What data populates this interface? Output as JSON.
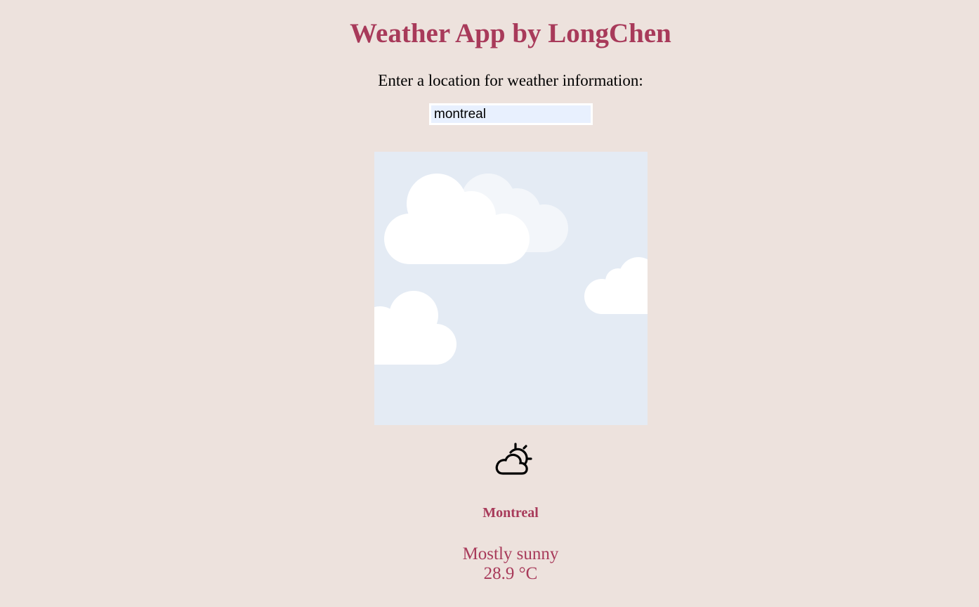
{
  "app": {
    "title": "Weather App by LongChen"
  },
  "search": {
    "prompt": "Enter a location for weather information:",
    "value": "montreal"
  },
  "weather": {
    "image_icon": "clouds-illustration",
    "condition_icon": "partly-sunny-icon",
    "city": "Montreal",
    "condition": "Mostly sunny",
    "temperature": "28.9 °C"
  },
  "colors": {
    "background": "#ede2dd",
    "accent": "#a83a5a",
    "sky": "#e4ebf4",
    "input_background": "#e8f0fe"
  }
}
